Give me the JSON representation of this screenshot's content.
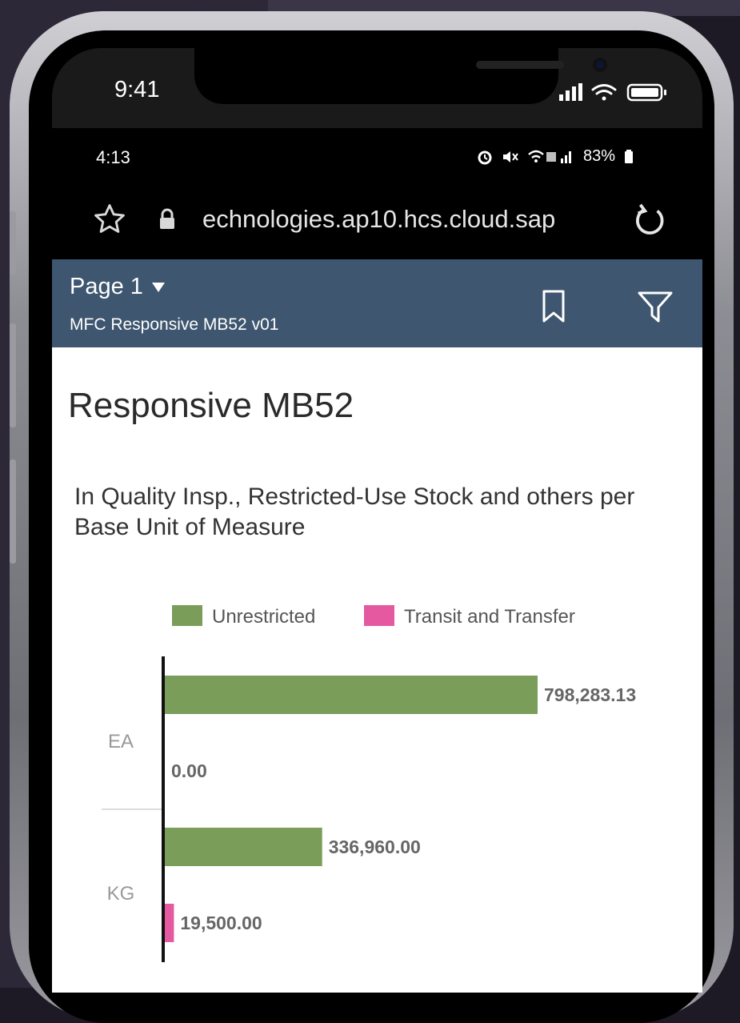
{
  "ios_status": {
    "time": "9:41"
  },
  "android_status": {
    "time": "4:13",
    "battery": "83%"
  },
  "browser": {
    "url": "echnologies.ap10.hcs.cloud.sap"
  },
  "shell": {
    "page_label": "Page 1",
    "story_name": "MFC Responsive MB52 v01"
  },
  "content": {
    "page_title": "Responsive MB52",
    "chart_title": "In Quality Insp., Restricted-Use Stock and others per Base Unit of Measure"
  },
  "colors": {
    "unrestricted": "#7a9e5a",
    "transit": "#e4599f",
    "header": "#3e566f"
  },
  "chart_data": {
    "type": "bar",
    "orientation": "horizontal",
    "categories": [
      "EA",
      "KG"
    ],
    "series": [
      {
        "name": "Unrestricted",
        "values": [
          798283.13,
          336960.0
        ],
        "labels": [
          "798,283.13",
          "336,960.00"
        ]
      },
      {
        "name": "Transit and Transfer",
        "values": [
          0.0,
          19500.0
        ],
        "labels": [
          "0.00",
          "19,500.00"
        ]
      }
    ],
    "title": "In Quality Insp., Restricted-Use Stock and others per Base Unit of Measure",
    "legend": "top",
    "xlim": [
      0,
      798283.13
    ],
    "grid": false
  }
}
